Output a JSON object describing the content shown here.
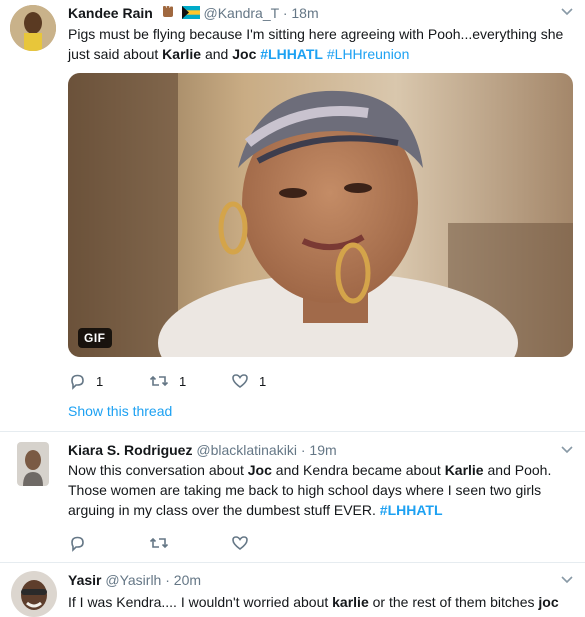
{
  "tweets": [
    {
      "name": "Kandee Rain",
      "handle": "@Kandra_T",
      "dot": "·",
      "time": "18m",
      "text_parts": [
        "Pigs must be flying because I'm sitting here agreeing with Pooh...everything she just said about ",
        "Karlie",
        " and ",
        "Joc",
        " ",
        "#LHHATL",
        " ",
        "#LHHreunion"
      ],
      "gif_badge": "GIF",
      "reply_count": "1",
      "retweet_count": "1",
      "like_count": "1",
      "show_thread": "Show this thread"
    },
    {
      "name": "Kiara S. Rodriguez",
      "handle": "@blacklatinakiki",
      "dot": "·",
      "time": "19m",
      "text_parts": [
        "Now this conversation about ",
        "Joc",
        " and Kendra became about ",
        "Karlie",
        " and Pooh. Those women are taking me back to high school days where I seen two girls arguing in my class over the dumbest stuff EVER. ",
        "#LHHATL"
      ]
    },
    {
      "name": "Yasir",
      "handle": "@Yasirlh",
      "dot": "·",
      "time": "20m",
      "text_parts": [
        "If I was Kendra.... I wouldn't worried about ",
        "karlie",
        " or the rest of them bitches ",
        "joc"
      ]
    }
  ],
  "colors": {
    "link": "#1da1f2",
    "muted": "#657786",
    "text": "#14171a",
    "divider": "#e6ecf0"
  },
  "icons": [
    "reply-icon",
    "retweet-icon",
    "like-icon",
    "caret-down-icon",
    "raised-fist-emoji",
    "bahamas-flag-emoji"
  ]
}
